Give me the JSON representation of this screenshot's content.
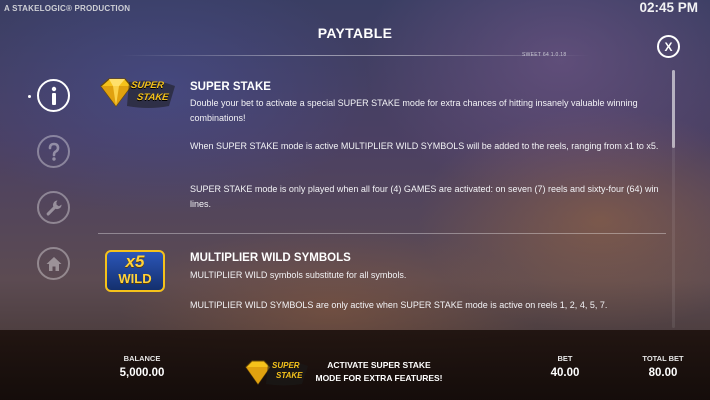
{
  "header": {
    "brand": "A STAKELOGIC® PRODUCTION",
    "clock": "02:45 PM",
    "title": "PAYTABLE",
    "version": "SWEET 64 1.0.18",
    "close_label": "X"
  },
  "nav": {
    "items": [
      {
        "name": "info",
        "icon": "info-icon",
        "active": true
      },
      {
        "name": "help",
        "icon": "question-icon",
        "active": false
      },
      {
        "name": "settings",
        "icon": "wrench-icon",
        "active": false
      },
      {
        "name": "home",
        "icon": "home-icon",
        "active": false
      }
    ]
  },
  "sections": {
    "super_stake": {
      "logo_line1": "SUPER",
      "logo_line2": "STAKE",
      "title": "SUPER STAKE",
      "p1": "Double your bet to activate a special SUPER STAKE mode for extra chances of hitting insanely valuable winning combinations!",
      "p2": "When SUPER STAKE mode is active MULTIPLIER WILD SYMBOLS will be added to the reels, ranging from x1 to x5.",
      "p3": "SUPER STAKE mode is only played when all four (4) GAMES are activated: on seven (7) reels and sixty-four (64) win lines."
    },
    "multiplier_wild": {
      "logo_top": "x5",
      "logo_bottom": "WILD",
      "title": "MULTIPLIER WILD SYMBOLS",
      "p1": "MULTIPLIER WILD symbols substitute for all symbols.",
      "p2": "MULTIPLIER WILD SYMBOLS are only active when SUPER STAKE mode is active on reels 1, 2, 4, 5, 7."
    }
  },
  "footer": {
    "balance_label": "BALANCE",
    "balance_value": "5,000.00",
    "promo_logo_line1": "SUPER",
    "promo_logo_line2": "STAKE",
    "promo_text": "ACTIVATE SUPER STAKE MODE FOR EXTRA FEATURES!",
    "bet_label": "BET",
    "bet_value": "40.00",
    "total_bet_label": "TOTAL BET",
    "total_bet_value": "80.00"
  },
  "colors": {
    "gold": "#f5c21b",
    "wild_blue": "#1f3f8f"
  }
}
